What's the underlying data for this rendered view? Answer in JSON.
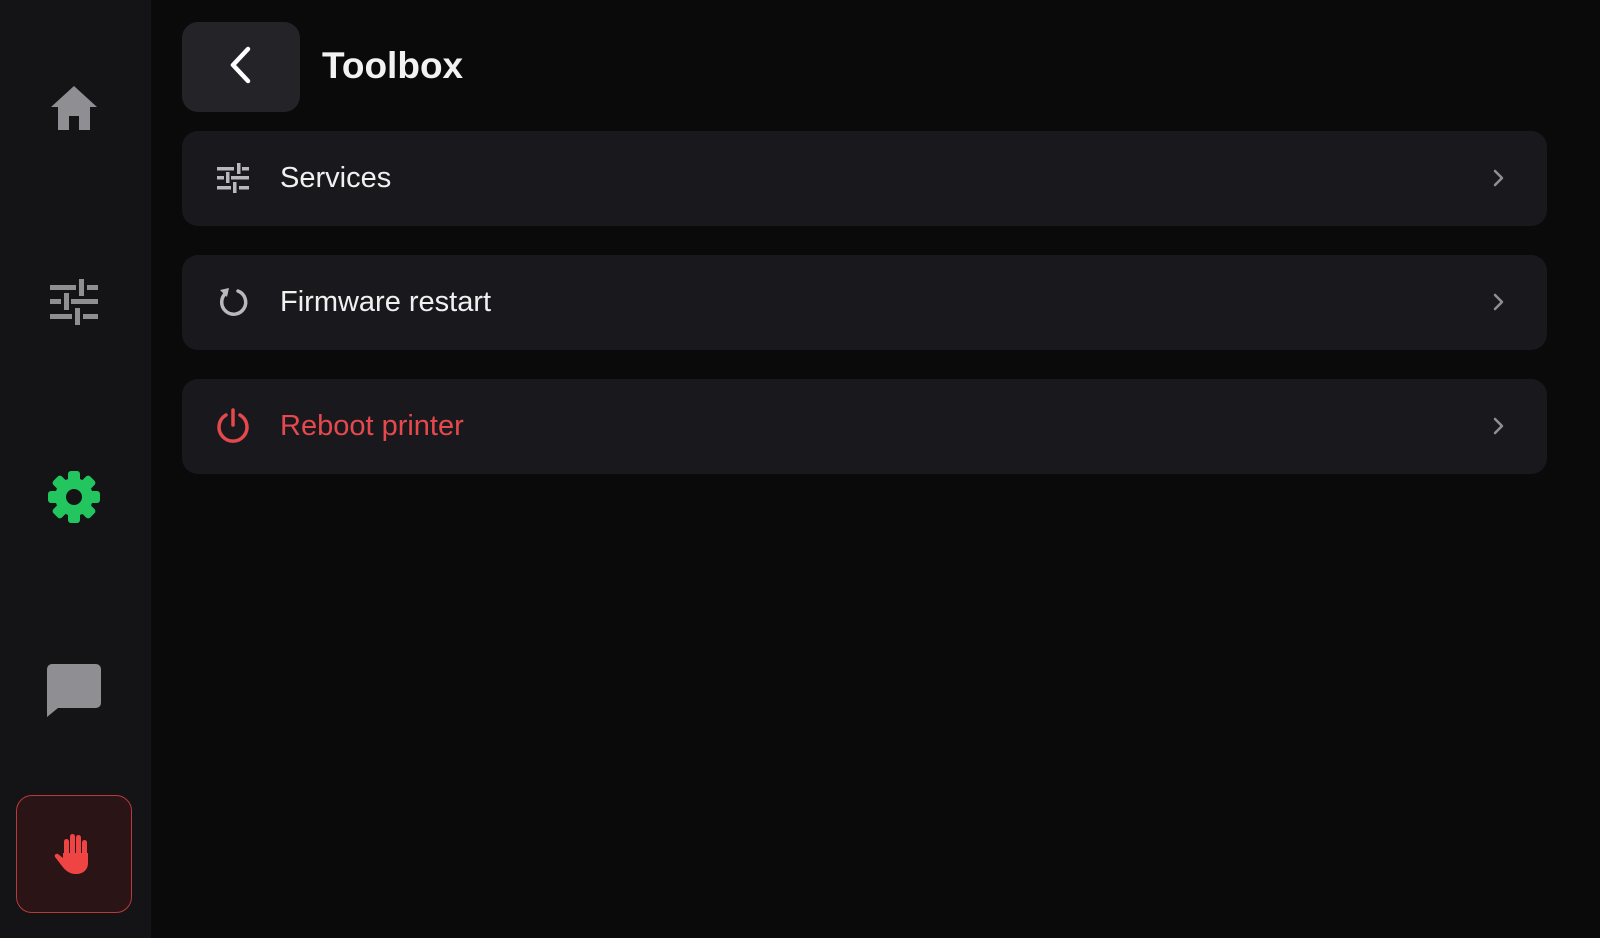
{
  "header": {
    "title": "Toolbox",
    "back_icon": "chevron-left-icon"
  },
  "sidebar": {
    "items": [
      {
        "id": "home",
        "icon": "home-icon",
        "active": false
      },
      {
        "id": "controls",
        "icon": "sliders-icon",
        "active": false
      },
      {
        "id": "settings",
        "icon": "gear-icon",
        "active": true
      },
      {
        "id": "console",
        "icon": "chat-bubble-icon",
        "active": false
      },
      {
        "id": "emergency-stop",
        "icon": "hand-stop-icon",
        "active": false
      }
    ]
  },
  "menu": {
    "items": [
      {
        "id": "services",
        "label": "Services",
        "icon": "sliders-icon",
        "danger": false
      },
      {
        "id": "firmware-restart",
        "label": "Firmware restart",
        "icon": "restart-icon",
        "danger": false
      },
      {
        "id": "reboot-printer",
        "label": "Reboot printer",
        "icon": "power-icon",
        "danger": true
      }
    ]
  },
  "colors": {
    "background": "#0a0a0b",
    "sidebar": "#141417",
    "card": "#19191d",
    "accent_active": "#22c55e",
    "danger": "#e5484d",
    "icon_muted": "#8e8e93"
  }
}
